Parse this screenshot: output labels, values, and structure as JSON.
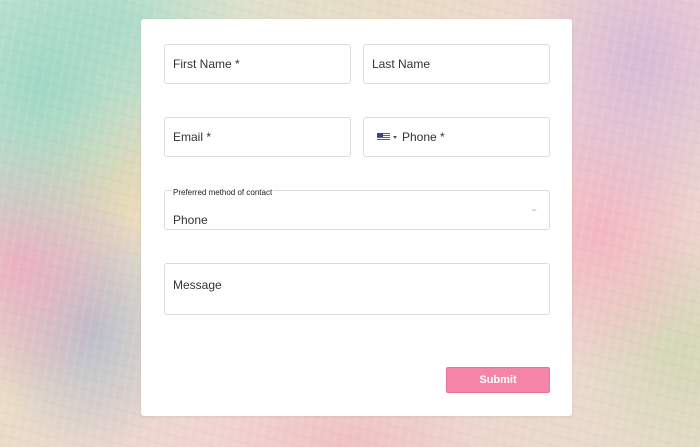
{
  "form": {
    "first_name": {
      "placeholder": "First Name *"
    },
    "last_name": {
      "placeholder": "Last Name"
    },
    "email": {
      "placeholder": "Email  *"
    },
    "phone": {
      "placeholder": "Phone *",
      "country_flag_icon": "us-flag-icon"
    },
    "contact_method": {
      "label": "Preferred method of contact",
      "value": "Phone"
    },
    "message": {
      "placeholder": "Message"
    },
    "submit": {
      "label": "Submit"
    }
  },
  "colors": {
    "submit_background": "#f585a8",
    "card_background": "#ffffff",
    "field_border": "#dcdcdc"
  }
}
